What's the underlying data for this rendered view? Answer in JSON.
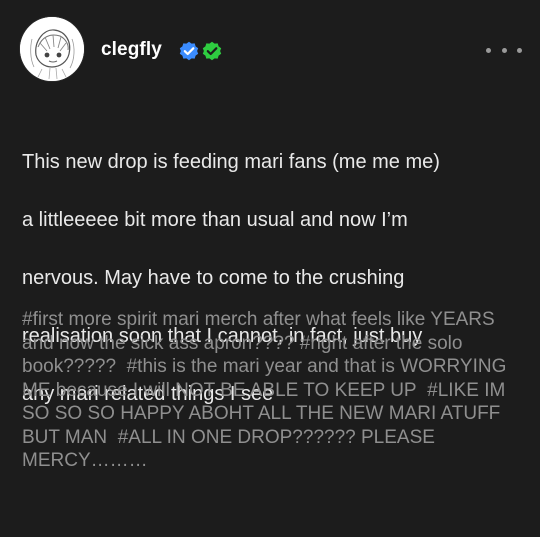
{
  "post": {
    "author": {
      "blog_name": "clegfly",
      "avatar": "avatar-sketch-drawing",
      "badges": [
        {
          "icon": "verified-check-badge",
          "color": "#3b8cff"
        },
        {
          "icon": "verified-check-badge",
          "color": "#2ecc40"
        }
      ]
    },
    "menu_icon": "more-options-icon",
    "body_lines": [
      "This new drop is feeding mari fans (me me me)",
      "a littleeeee bit more than usual and now I’m",
      "nervous. May have to come to the crushing",
      "realisation soon that I cannot, in fact, just buy",
      "any mari related things I see"
    ],
    "tags": [
      "#first more spirit mari merch after what feels like YEARS and now the sick ass apron????",
      "#right after the solo book?????",
      "#this is the mari year and that is WORRYING ME because I will NOT BE ABLE TO KEEP UP",
      "#LIKE IM SO SO SO HAPPY ABOHT ALL THE NEW MARI ATUFF BUT MAN",
      "#ALL IN ONE DROP??????",
      "PLEASE MERCY………"
    ]
  },
  "colors": {
    "background": "#1c1c1c",
    "text_primary": "#e9e9e9",
    "text_tags": "#8f8f8f",
    "badge_blue": "#3b8cff",
    "badge_green": "#2ecc40"
  }
}
